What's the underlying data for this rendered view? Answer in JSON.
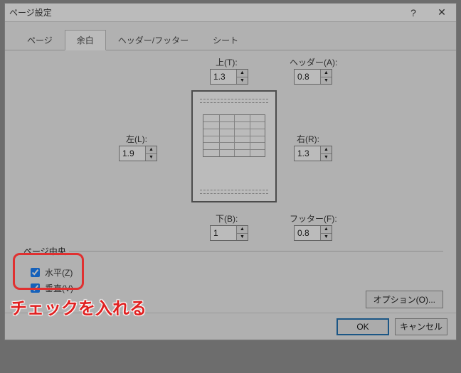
{
  "title": "ページ設定",
  "help": "?",
  "close": "✕",
  "tabs": [
    "ページ",
    "余白",
    "ヘッダー/フッター",
    "シート"
  ],
  "activeTab": 1,
  "margins": {
    "top": {
      "label": "上(T):",
      "value": "1.3"
    },
    "header": {
      "label": "ヘッダー(A):",
      "value": "0.8"
    },
    "left": {
      "label": "左(L):",
      "value": "1.9"
    },
    "right": {
      "label": "右(R):",
      "value": "1.3"
    },
    "bottom": {
      "label": "下(B):",
      "value": "1"
    },
    "footer": {
      "label": "フッター(F):",
      "value": "0.8"
    }
  },
  "centerGroup": {
    "label": "ページ中央",
    "horizontal": "水平(Z)",
    "vertical": "垂直(V)"
  },
  "options": "オプション(O)...",
  "ok": "OK",
  "cancel": "キャンセル",
  "annotation": "チェックを入れる"
}
